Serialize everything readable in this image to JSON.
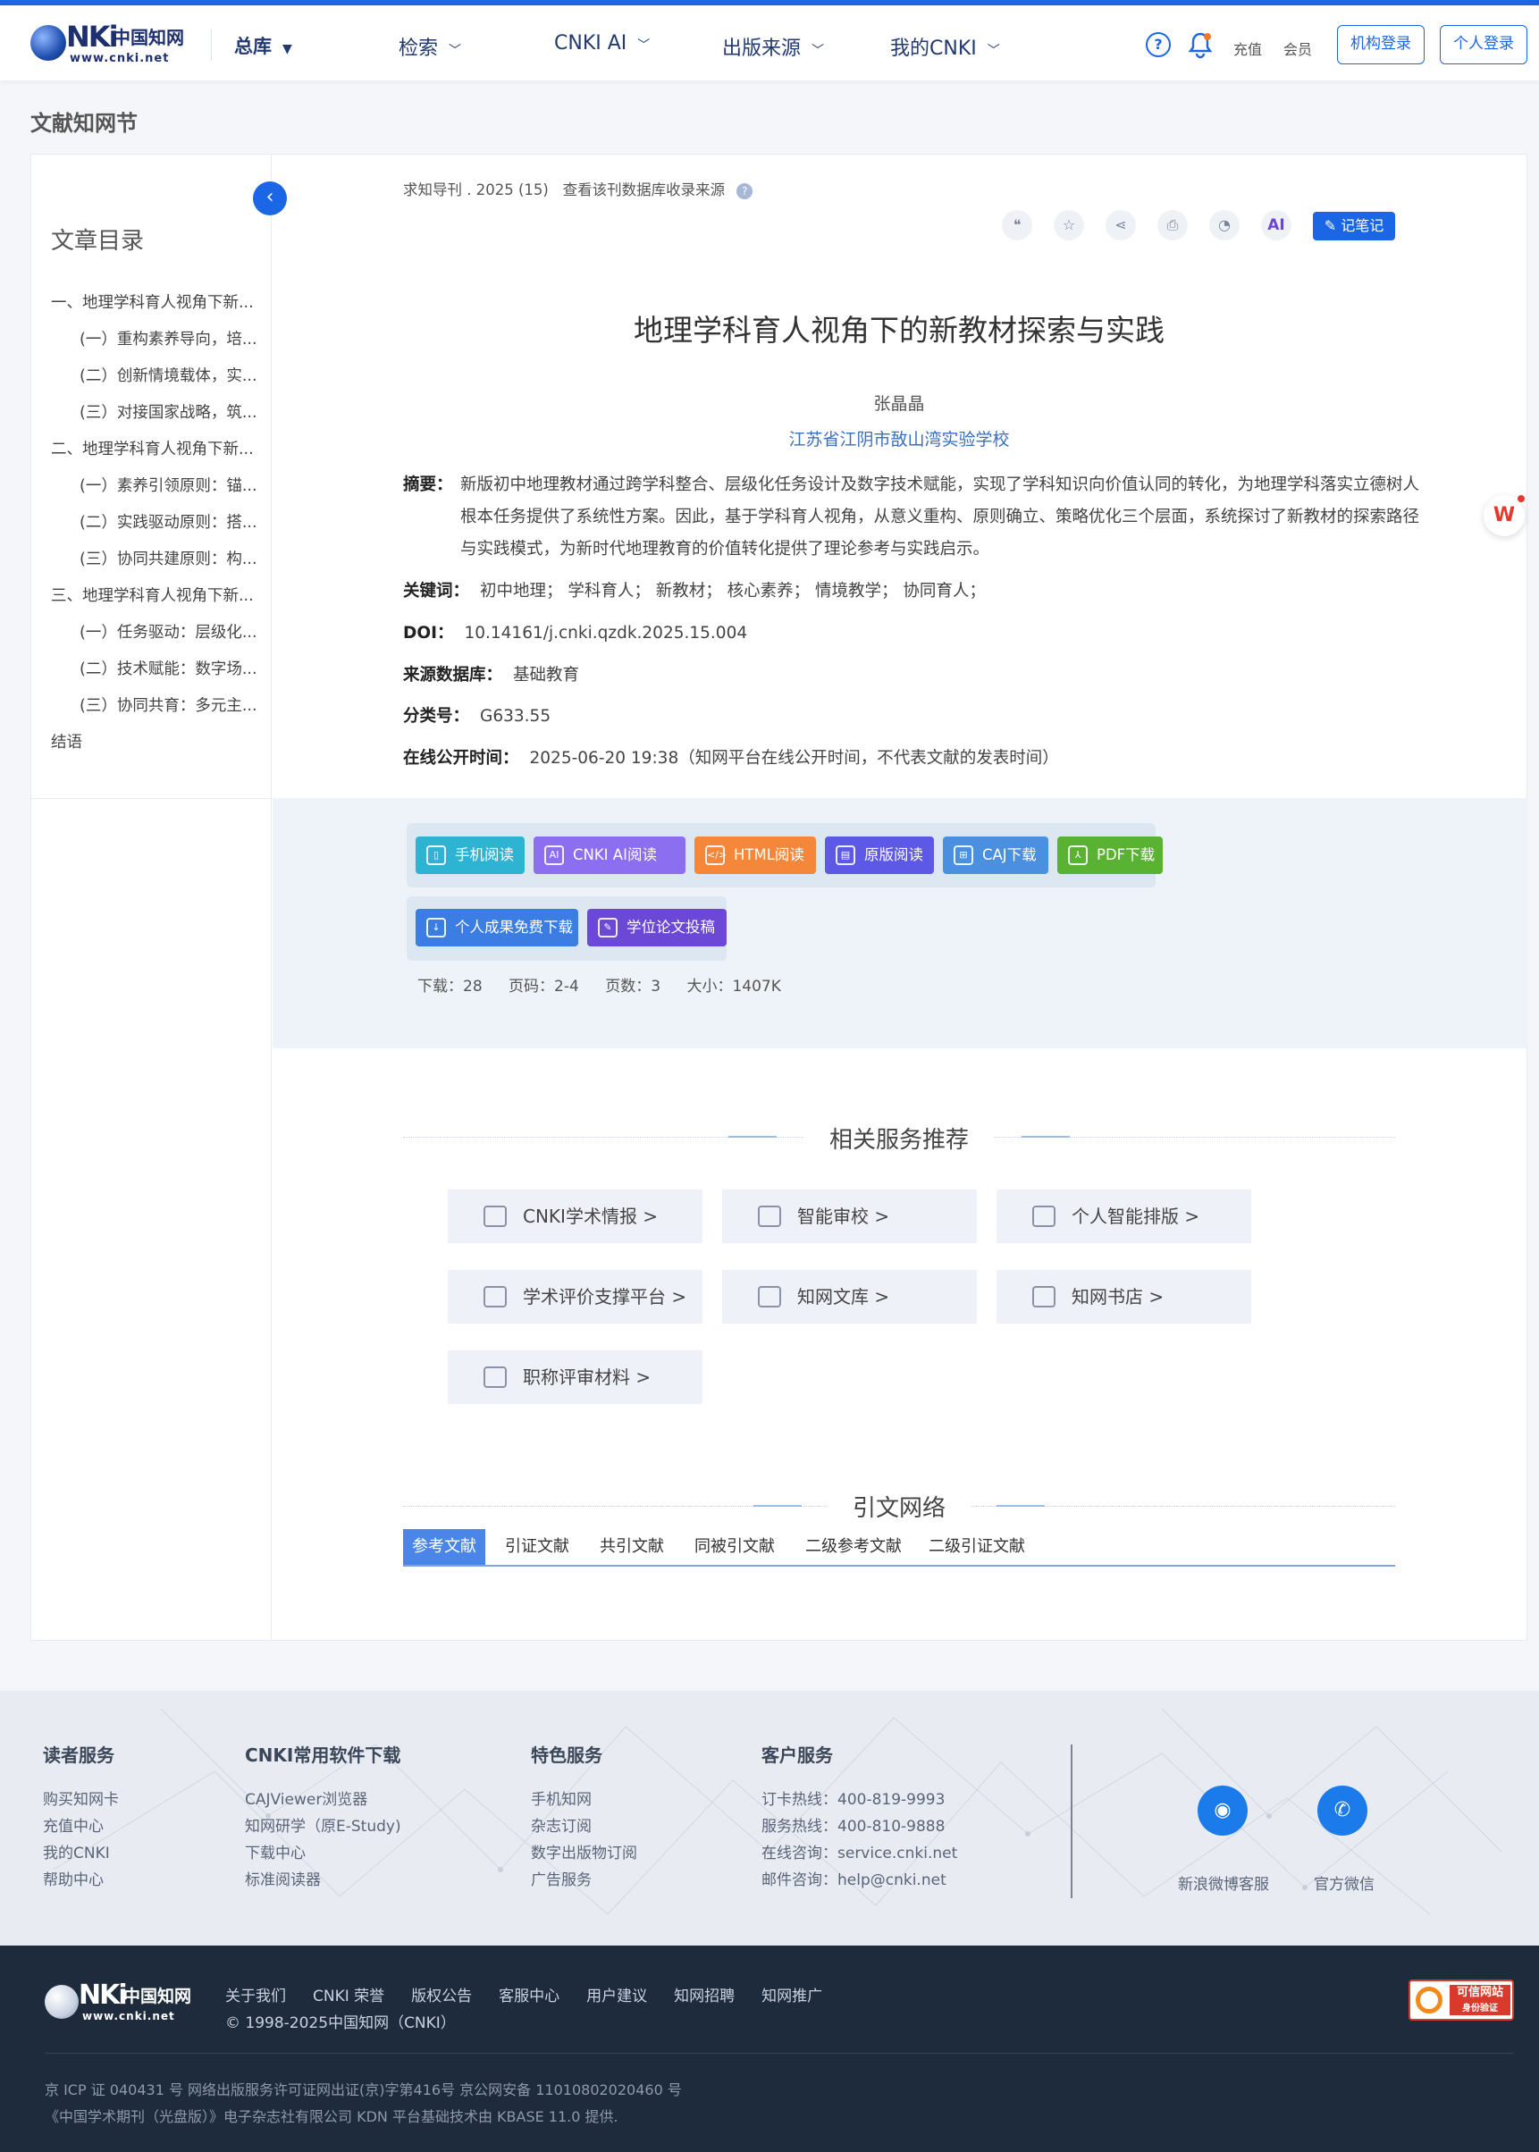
{
  "header": {
    "logo_cn": "中国知网",
    "logo_url": "www.cnki.net",
    "library": "总库",
    "nav": [
      "检索",
      "CNKI AI",
      "出版来源",
      "我的CNKI"
    ],
    "recharge": "充值",
    "member": "会员",
    "inst_login": "机构登录",
    "personal_login": "个人登录"
  },
  "page_title": "文献知网节",
  "sidebar": {
    "title": "文章目录",
    "items": [
      {
        "label": "一、地理学科育人视角下新...",
        "level": 1
      },
      {
        "label": "(一）重构素养导向，培...",
        "level": 2
      },
      {
        "label": "(二）创新情境载体，实...",
        "level": 2
      },
      {
        "label": "(三）对接国家战略，筑...",
        "level": 2
      },
      {
        "label": "二、地理学科育人视角下新...",
        "level": 1
      },
      {
        "label": "(一）素养引领原则：锚...",
        "level": 2
      },
      {
        "label": "(二）实践驱动原则：搭...",
        "level": 2
      },
      {
        "label": "(三）协同共建原则：构...",
        "level": 2
      },
      {
        "label": "三、地理学科育人视角下新...",
        "level": 1
      },
      {
        "label": "(一）任务驱动：层级化...",
        "level": 2
      },
      {
        "label": "(二）技术赋能：数字场...",
        "level": 2
      },
      {
        "label": "(三）协同共育：多元主...",
        "level": 2
      },
      {
        "label": "结语",
        "level": 1
      }
    ]
  },
  "article": {
    "source": "求知导刊 . 2025 (15)",
    "source_link": "查看该刊数据库收录来源",
    "note_button": "记笔记",
    "tool_ai": "AI",
    "title": "地理学科育人视角下的新教材探索与实践",
    "author": "张晶晶",
    "org": "江苏省江阴市敔山湾实验学校",
    "abstract_label": "摘要：",
    "abstract": "新版初中地理教材通过跨学科整合、层级化任务设计及数字技术赋能，实现了学科知识向价值认同的转化，为地理学科落实立德树人根本任务提供了系统性方案。因此，基于学科育人视角，从意义重构、原则确立、策略优化三个层面，系统探讨了新教材的探索路径与实践模式，为新时代地理教育的价值转化提供了理论参考与实践启示。",
    "keywords_label": "关键词：",
    "keywords": "初中地理； 学科育人； 新教材； 核心素养； 情境教学； 协同育人；",
    "doi_label": "DOI：",
    "doi": "10.14161/j.cnki.qzdk.2025.15.004",
    "db_label": "来源数据库：",
    "db": "基础教育",
    "class_label": "分类号：",
    "class": "G633.55",
    "online_label": "在线公开时间：",
    "online": "2025-06-20 19:38（知网平台在线公开时间，不代表文献的发表时间）"
  },
  "downloads": {
    "buttons": [
      {
        "label": "手机阅读",
        "color": "#2fb3d3"
      },
      {
        "label": "CNKI AI阅读",
        "color": "#8c6ef0"
      },
      {
        "label": "HTML阅读",
        "color": "#f4873a"
      },
      {
        "label": "原版阅读",
        "color": "#5d58e6"
      },
      {
        "label": "CAJ下载",
        "color": "#4a8fe0"
      },
      {
        "label": "PDF下载",
        "color": "#59b231"
      },
      {
        "label": "个人成果免费下载",
        "color": "#3b7de3"
      },
      {
        "label": "学位论文投稿",
        "color": "#6b48d6"
      }
    ],
    "stats": {
      "downloads": "下载：28",
      "pages": "页码：2-4",
      "page_count": "页数：3",
      "size": "大小：1407K"
    }
  },
  "services": {
    "title": "相关服务推荐",
    "items": [
      "CNKI学术情报 >",
      "智能审校 >",
      "个人智能排版 >",
      "学术评价支撑平台 >",
      "知网文库 >",
      "知网书店 >",
      "职称评审材料 >"
    ]
  },
  "citation": {
    "title": "引文网络",
    "tabs": [
      "参考文献",
      "引证文献",
      "共引文献",
      "同被引文献",
      "二级参考文献",
      "二级引证文献"
    ]
  },
  "footer": {
    "cols": [
      {
        "title": "读者服务",
        "items": [
          "购买知网卡",
          "充值中心",
          "我的CNKI",
          "帮助中心"
        ]
      },
      {
        "title": "CNKI常用软件下载",
        "items": [
          "CAJViewer浏览器",
          "知网研学（原E-Study)",
          "下载中心",
          "标准阅读器"
        ]
      },
      {
        "title": "特色服务",
        "items": [
          "手机知网",
          "杂志订阅",
          "数字出版物订阅",
          "广告服务"
        ]
      },
      {
        "title": "客户服务",
        "items": [
          "订卡热线：400-819-9993",
          "服务热线：400-810-9888",
          "在线咨询：service.cnki.net",
          "邮件咨询：help@cnki.net"
        ]
      }
    ],
    "weibo": "新浪微博客服",
    "wechat": "官方微信",
    "links": [
      "关于我们",
      "CNKI 荣誉",
      "版权公告",
      "客服中心",
      "用户建议",
      "知网招聘",
      "知网推广"
    ],
    "copyright": "© 1998-2025中国知网（CNKI）",
    "trust_badge": "可信网站",
    "trust_badge_sub": "身份验证",
    "legal1": "京 ICP 证 040431 号 网络出版服务许可证网出证(京)字第416号 京公网安备 11010802020460 号",
    "legal2": "《中国学术期刊（光盘版）》电子杂志社有限公司 KDN 平台基础技术由 KBASE 11.0 提供."
  }
}
